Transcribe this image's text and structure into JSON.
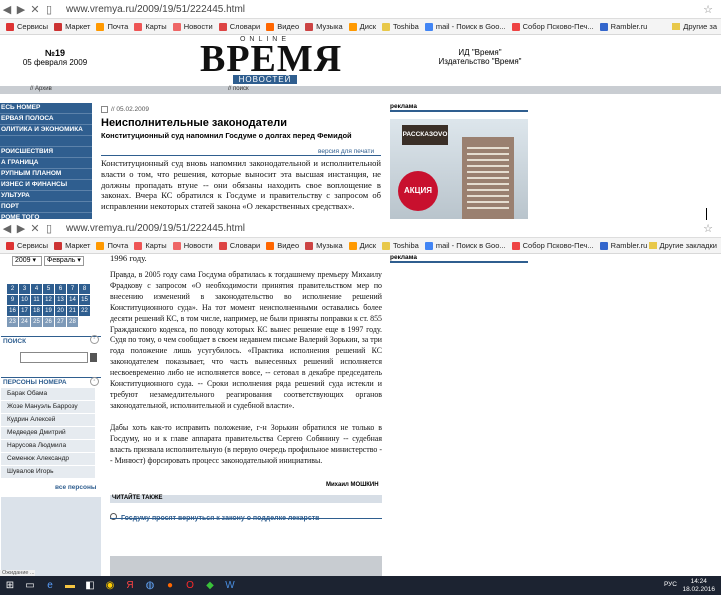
{
  "browser": {
    "url": "www.vremya.ru/2009/19/51/222445.html",
    "bookmarks": [
      "Сервисы",
      "Маркет",
      "Почта",
      "Карты",
      "Новости",
      "Словари",
      "Видео",
      "Музыка",
      "Диск",
      "Toshiba",
      "mail - Поиск в Goo...",
      "Собор Псково-Печ...",
      "Rambler.ru"
    ],
    "bookmarks2": [
      "Сервисы",
      "Маркет",
      "Почта",
      "Карты",
      "Новости",
      "Словари",
      "Видео",
      "Музыка",
      "Диск",
      "Toshiba",
      "mail - Поиск в Goo...",
      "Собор Псково-Печ...",
      "Rambler.ru"
    ],
    "other_bookmarks": "Другие закладки",
    "other_bookmarks_short": "Другие за"
  },
  "header": {
    "issue": "№19",
    "date": "05 февраля 2009",
    "online": "ONLINE",
    "logo": "ВРЕМЯ",
    "news": "НОВОСТЕЙ",
    "publisher_line1": "ИД \"Время\"",
    "publisher_line2": "Издательство \"Время\"",
    "archive": "// Архив",
    "search": "// поиск"
  },
  "menu": [
    "ЕСЬ НОМЕР",
    "ЕРВАЯ ПОЛОСА",
    "ОЛИТИКА И ЭКОНОМИКА",
    "",
    "РОИСШЕСТВИЯ",
    "А ГРАНИЦА",
    "РУПНЫМ ПЛАНОМ",
    "ИЗНЕС И ФИНАНСЫ",
    "УЛЬТУРА",
    "ПОРТ",
    "РОМЕ ТОГО"
  ],
  "article": {
    "date": "// 05.02.2009",
    "title": "Неисполнительные законодатели",
    "subtitle": "Конституционный суд напомнил Госдуме о долгах перед Фемидой",
    "print_version": "версия для печати",
    "lead": "Конституционный суд вновь напомнил законодательной и исполнительной власти о том, что решения, которые выносит эта высшая инстанция, не должны пропадать втуне -- они обязаны находить свое воплощение в законах. Вчера КС обратился к Госдуме и правительству с запросом об исправлении некоторых статей закона «О лекарственных средствах».",
    "year_tail": "1996 году.",
    "p2": "Правда, в 2005 году сама Госдума обратилась к тогдашнему премьеру Михаилу Фрадкову с запросом «О необходимости принятия правительством мер по внесению изменений в законодательство во исполнение решений Конституционного суда». На тот момент неисполненными оставались более десяти решений КС, в том числе, например, не были приняты поправки к ст. 855 Гражданского кодекса, по поводу которых КС вынес решение еще в 1997 году. Судя по тому, о чем сообщает в своем недавнем письме Валерий Зорькин, за три года положение лишь усугубилось. «Практика исполнения решений КС законодателем показывает, что часть вынесенных решений исполняется несвоевременно либо не исполняется вовсе, -- сетовал в декабре председатель Конституционного суда. -- Сроки исполнения ряда решений суда истекли и требуют незамедлительного реагирования соответствующих органов законодательной, исполнительной и судебной власти».",
    "p3": "Дабы хоть как-то исправить положение, г-н Зорькин обратился не только в Госдуму, но и к главе аппарата правительства Сергею Собянину -- судебная власть призвала исполнительную (в первую очередь профильное министерство -- Минюст) форсировать процесс законодательной инициативы.",
    "author": "Михаил МОШКИН",
    "read_also": "ЧИТАЙТЕ ТАКЖЕ",
    "related": "Госдуму просят вернуться к закону о подделке лекарств"
  },
  "ad": {
    "label": "реклама",
    "brand": "РАССКАЗОVО",
    "promo": "АКЦИЯ"
  },
  "calendar": {
    "year": "2009",
    "month": "Февраль",
    "days": [
      "2",
      "3",
      "4",
      "5",
      "6",
      "7",
      "8",
      "9",
      "10",
      "11",
      "12",
      "13",
      "14",
      "15",
      "16",
      "17",
      "18",
      "19",
      "20",
      "21",
      "22",
      "23",
      "24",
      "25",
      "26",
      "27",
      "28"
    ]
  },
  "search_box": {
    "title": "ПОИСК"
  },
  "persons": {
    "title": "ПЕРСОНЫ НОМЕРА",
    "items": [
      "Барак Обама",
      "Жозе Мануэль Баррозу",
      "Кудрин Алексей",
      "Медведев Дмитрий",
      "Нарусова Людмила",
      "Семенюк Александр",
      "Шувалов Игорь"
    ],
    "all": "все персоны"
  },
  "status_text": "Ожидание ...",
  "taskbar": {
    "time": "14:24",
    "date": "18.02.2016",
    "lang": "РУС"
  },
  "colors": {
    "accent": "#2f5e8f",
    "ad_red": "#c8102e"
  }
}
